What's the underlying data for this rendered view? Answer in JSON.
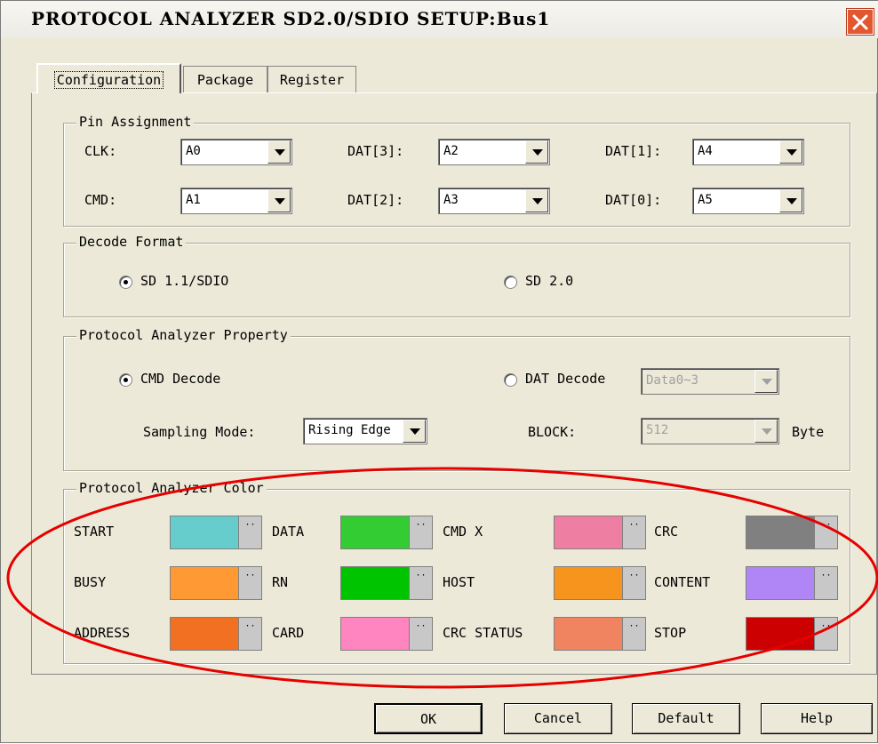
{
  "window": {
    "title": "PROTOCOL ANALYZER SD2.0/SDIO SETUP:Bus1"
  },
  "tabs": [
    {
      "label": "Configuration",
      "active": true
    },
    {
      "label": "Package",
      "active": false
    },
    {
      "label": "Register",
      "active": false
    }
  ],
  "pin_assignment": {
    "title": "Pin Assignment",
    "pins": [
      {
        "label": "CLK:",
        "value": "A0"
      },
      {
        "label": "DAT[3]:",
        "value": "A2"
      },
      {
        "label": "DAT[1]:",
        "value": "A4"
      },
      {
        "label": "CMD:",
        "value": "A1"
      },
      {
        "label": "DAT[2]:",
        "value": "A3"
      },
      {
        "label": "DAT[0]:",
        "value": "A5"
      }
    ]
  },
  "decode_format": {
    "title": "Decode Format",
    "options": [
      {
        "label": "SD 1.1/SDIO",
        "checked": true
      },
      {
        "label": "SD 2.0",
        "checked": false
      }
    ]
  },
  "property": {
    "title": "Protocol Analyzer Property",
    "cmd_decode": {
      "label": "CMD Decode",
      "checked": true
    },
    "dat_decode": {
      "label": "DAT Decode",
      "checked": false,
      "value": "Data0~3"
    },
    "sampling_mode": {
      "label": "Sampling Mode:",
      "value": "Rising Edge"
    },
    "block": {
      "label": "BLOCK:",
      "value": "512",
      "unit": "Byte"
    }
  },
  "colors": {
    "title": "Protocol Analyzer Color",
    "dots": "··",
    "items": [
      {
        "label": "START",
        "color": "#66cccc"
      },
      {
        "label": "DATA",
        "color": "#33cc33"
      },
      {
        "label": "CMD X",
        "color": "#ee7fa2"
      },
      {
        "label": "CRC",
        "color": "#808080"
      },
      {
        "label": "BUSY",
        "color": "#ff9933"
      },
      {
        "label": "RN",
        "color": "#00c400"
      },
      {
        "label": "HOST",
        "color": "#f7941d"
      },
      {
        "label": "CONTENT",
        "color": "#b085f5"
      },
      {
        "label": "ADDRESS",
        "color": "#f27021"
      },
      {
        "label": "CARD",
        "color": "#ff85c0"
      },
      {
        "label": "CRC STATUS",
        "color": "#f08460"
      },
      {
        "label": "STOP",
        "color": "#cc0000"
      }
    ]
  },
  "buttons": {
    "ok": "OK",
    "cancel": "Cancel",
    "default": "Default",
    "help": "Help"
  }
}
